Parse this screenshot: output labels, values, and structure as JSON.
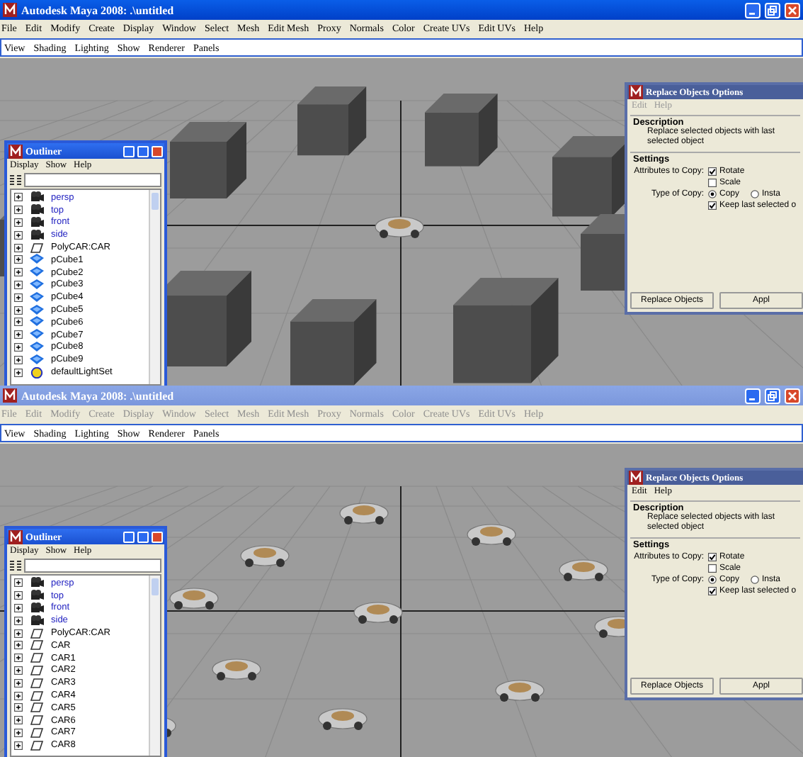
{
  "panels": [
    {
      "window": {
        "title": "Autodesk Maya 2008: .\\untitled",
        "active": true
      },
      "menu": [
        "File",
        "Edit",
        "Modify",
        "Create",
        "Display",
        "Window",
        "Select",
        "Mesh",
        "Edit Mesh",
        "Proxy",
        "Normals",
        "Color",
        "Create UVs",
        "Edit UVs",
        "Help"
      ],
      "viewport_menu": [
        "View",
        "Shading",
        "Lighting",
        "Show",
        "Renderer",
        "Panels"
      ],
      "viewport": {
        "kind": "cubes"
      },
      "outliner": {
        "title": "Outliner",
        "menu": [
          "Display",
          "Show",
          "Help"
        ],
        "items": [
          {
            "kind": "camera",
            "label": "persp"
          },
          {
            "kind": "camera",
            "label": "top"
          },
          {
            "kind": "camera",
            "label": "front"
          },
          {
            "kind": "camera",
            "label": "side"
          },
          {
            "kind": "transform",
            "label": "PolyCAR:CAR"
          },
          {
            "kind": "mesh",
            "label": "pCube1"
          },
          {
            "kind": "mesh",
            "label": "pCube2"
          },
          {
            "kind": "mesh",
            "label": "pCube3"
          },
          {
            "kind": "mesh",
            "label": "pCube4"
          },
          {
            "kind": "mesh",
            "label": "pCube5"
          },
          {
            "kind": "mesh",
            "label": "pCube6"
          },
          {
            "kind": "mesh",
            "label": "pCube7"
          },
          {
            "kind": "mesh",
            "label": "pCube8"
          },
          {
            "kind": "mesh",
            "label": "pCube9"
          },
          {
            "kind": "set",
            "label": "defaultLightSet"
          }
        ]
      },
      "dialog": {
        "title": "Replace Objects Options",
        "menu": [
          {
            "label": "Edit",
            "disabled": true
          },
          {
            "label": "Help",
            "disabled": true
          }
        ],
        "description_heading": "Description",
        "description": "Replace selected objects with last selected object",
        "settings_heading": "Settings",
        "attributes_label": "Attributes to Copy:",
        "rotate": {
          "label": "Rotate",
          "checked": true
        },
        "scale": {
          "label": "Scale",
          "checked": false
        },
        "type_label": "Type of Copy:",
        "type_options": [
          {
            "label": "Copy",
            "selected": true
          },
          {
            "label": "Insta",
            "selected": false
          }
        ],
        "keep": {
          "label": "Keep last selected o",
          "checked": true
        },
        "buttons": [
          "Replace Objects",
          "Appl"
        ]
      }
    },
    {
      "window": {
        "title": "Autodesk Maya 2008: .\\untitled",
        "active": false
      },
      "menu": [
        "File",
        "Edit",
        "Modify",
        "Create",
        "Display",
        "Window",
        "Select",
        "Mesh",
        "Edit Mesh",
        "Proxy",
        "Normals",
        "Color",
        "Create UVs",
        "Edit UVs",
        "Help"
      ],
      "viewport_menu": [
        "View",
        "Shading",
        "Lighting",
        "Show",
        "Renderer",
        "Panels"
      ],
      "viewport": {
        "kind": "cars"
      },
      "outliner": {
        "title": "Outliner",
        "menu": [
          "Display",
          "Show",
          "Help"
        ],
        "items": [
          {
            "kind": "camera",
            "label": "persp"
          },
          {
            "kind": "camera",
            "label": "top"
          },
          {
            "kind": "camera",
            "label": "front"
          },
          {
            "kind": "camera",
            "label": "side"
          },
          {
            "kind": "transform",
            "label": "PolyCAR:CAR"
          },
          {
            "kind": "transform",
            "label": "CAR"
          },
          {
            "kind": "transform",
            "label": "CAR1"
          },
          {
            "kind": "transform",
            "label": "CAR2"
          },
          {
            "kind": "transform",
            "label": "CAR3"
          },
          {
            "kind": "transform",
            "label": "CAR4"
          },
          {
            "kind": "transform",
            "label": "CAR5"
          },
          {
            "kind": "transform",
            "label": "CAR6"
          },
          {
            "kind": "transform",
            "label": "CAR7"
          },
          {
            "kind": "transform",
            "label": "CAR8"
          }
        ]
      },
      "dialog": {
        "title": "Replace Objects Options",
        "menu": [
          {
            "label": "Edit",
            "disabled": false
          },
          {
            "label": "Help",
            "disabled": false
          }
        ],
        "description_heading": "Description",
        "description": "Replace selected objects with last selected object",
        "settings_heading": "Settings",
        "attributes_label": "Attributes to Copy:",
        "rotate": {
          "label": "Rotate",
          "checked": true
        },
        "scale": {
          "label": "Scale",
          "checked": false
        },
        "type_label": "Type of Copy:",
        "type_options": [
          {
            "label": "Copy",
            "selected": true
          },
          {
            "label": "Insta",
            "selected": false
          }
        ],
        "keep": {
          "label": "Keep last selected o",
          "checked": true
        },
        "buttons": [
          "Replace Objects",
          "Appl"
        ]
      }
    }
  ]
}
